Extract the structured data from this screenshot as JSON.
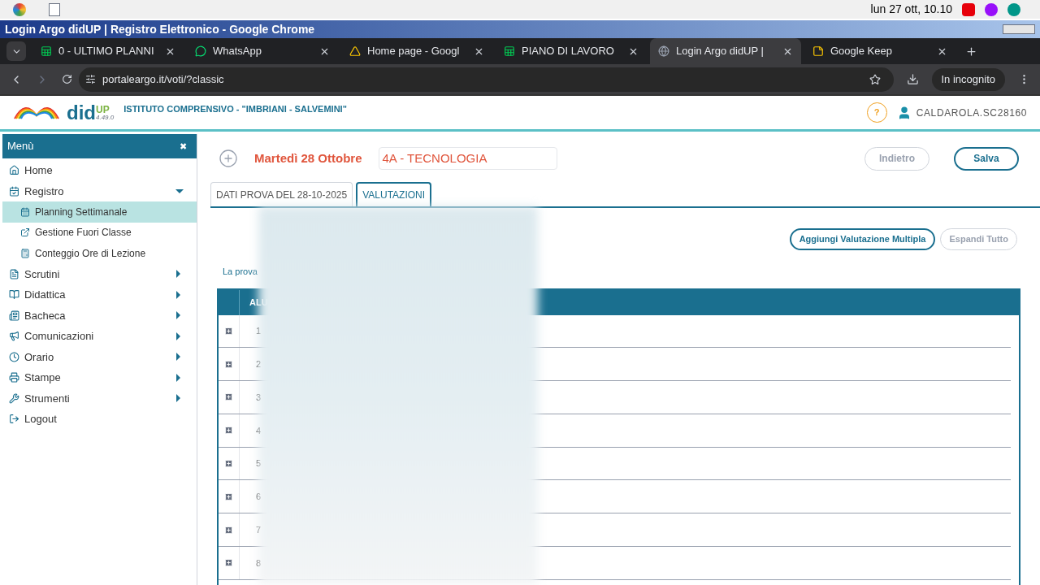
{
  "os_bar": {
    "clock": "lun 27 ott, 10.10"
  },
  "window": {
    "title": "Login Argo didUP | Registro Elettronico - Google Chrome"
  },
  "browser_tabs": [
    {
      "label": "0 - ULTIMO PLANNI",
      "kind": "sheet",
      "selected": false
    },
    {
      "label": "WhatsApp",
      "kind": "whatsapp",
      "selected": false
    },
    {
      "label": "Home page - Googl",
      "kind": "drive",
      "selected": false
    },
    {
      "label": "PIANO DI LAVORO",
      "kind": "sheet",
      "selected": false
    },
    {
      "label": "Login Argo didUP |",
      "kind": "globe",
      "selected": true
    },
    {
      "label": "Google Keep",
      "kind": "keep",
      "selected": false
    }
  ],
  "address_bar": {
    "url": "portaleargo.it/voti/?classic",
    "incognito": "In incognito"
  },
  "header": {
    "logo": "did",
    "logo_sup": "UP",
    "version": "4.49.0",
    "school": "ISTITUTO COMPRENSIVO - \"IMBRIANI - SALVEMINI\"",
    "help": "?",
    "user": "CALDAROLA.SC28160"
  },
  "sidebar": {
    "title": "Menù",
    "close": "✖",
    "items": [
      {
        "label": "Home",
        "kind": "home"
      },
      {
        "label": "Registro",
        "kind": "register",
        "expanded": true,
        "has_arrow": true,
        "children": [
          {
            "label": "Planning Settimanale",
            "kind": "calendar",
            "selected": true
          },
          {
            "label": "Gestione Fuori Classe",
            "kind": "external",
            "selected": false
          },
          {
            "label": "Conteggio Ore di Lezione",
            "kind": "calculator",
            "selected": false
          }
        ]
      },
      {
        "label": "Scrutini",
        "kind": "doc",
        "expanded": false,
        "has_arrow": true
      },
      {
        "label": "Didattica",
        "kind": "book",
        "expanded": false,
        "has_arrow": true
      },
      {
        "label": "Bacheca",
        "kind": "board",
        "expanded": false,
        "has_arrow": true
      },
      {
        "label": "Comunicazioni",
        "kind": "megaphone",
        "expanded": false,
        "has_arrow": true
      },
      {
        "label": "Orario",
        "kind": "clock",
        "expanded": false,
        "has_arrow": true
      },
      {
        "label": "Stampe",
        "kind": "printer",
        "expanded": false,
        "has_arrow": true
      },
      {
        "label": "Strumenti",
        "kind": "tools",
        "expanded": false,
        "has_arrow": true
      },
      {
        "label": "Logout",
        "kind": "logout"
      }
    ]
  },
  "toolbar": {
    "date": "Martedì 28 Ottobre",
    "class_subject": "4A - TECNOLOGIA",
    "buttons": [
      {
        "label": "Indietro",
        "disabled": true
      },
      {
        "label": "Salva",
        "disabled": false
      }
    ]
  },
  "tabs": [
    {
      "label": "DATI PROVA DEL 28-10-2025",
      "selected": false
    },
    {
      "label": "VALUTAZIONI",
      "selected": true
    }
  ],
  "actions": [
    {
      "label": "Aggiungi Valutazione Multipla",
      "disabled": false
    },
    {
      "label": "Espandi Tutto",
      "disabled": true
    }
  ],
  "note": "La prova",
  "table": {
    "column_1": "ALU",
    "rows": [
      "1",
      "2",
      "3",
      "4",
      "5",
      "6",
      "7",
      "8"
    ]
  }
}
